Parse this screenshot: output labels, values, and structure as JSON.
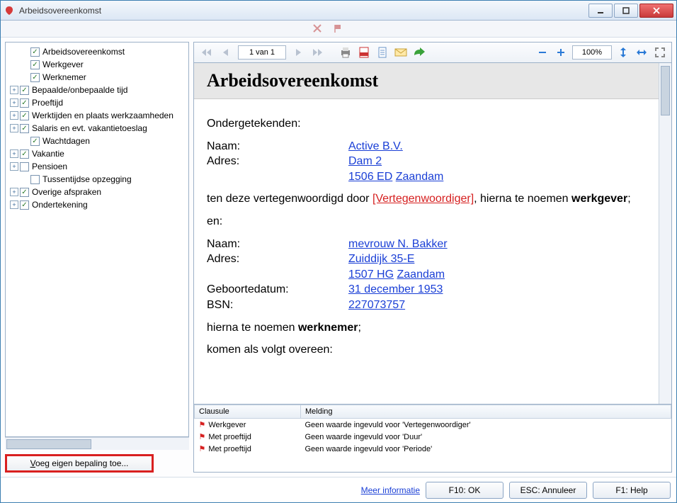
{
  "window": {
    "title": "Arbeidsovereenkomst"
  },
  "tree": {
    "items": [
      {
        "label": "Arbeidsovereenkomst",
        "checked": true,
        "expandable": false,
        "indent": 1
      },
      {
        "label": "Werkgever",
        "checked": true,
        "expandable": false,
        "indent": 1
      },
      {
        "label": "Werknemer",
        "checked": true,
        "expandable": false,
        "indent": 1
      },
      {
        "label": "Bepaalde/onbepaalde tijd",
        "checked": true,
        "expandable": true,
        "indent": 0
      },
      {
        "label": "Proeftijd",
        "checked": true,
        "expandable": true,
        "indent": 0
      },
      {
        "label": "Werktijden en plaats werkzaamheden",
        "checked": true,
        "expandable": true,
        "indent": 0
      },
      {
        "label": "Salaris en evt. vakantietoeslag",
        "checked": true,
        "expandable": true,
        "indent": 0
      },
      {
        "label": "Wachtdagen",
        "checked": true,
        "expandable": false,
        "indent": 1
      },
      {
        "label": "Vakantie",
        "checked": true,
        "expandable": true,
        "indent": 0
      },
      {
        "label": "Pensioen",
        "checked": false,
        "expandable": true,
        "indent": 0
      },
      {
        "label": "Tussentijdse opzegging",
        "checked": false,
        "expandable": false,
        "indent": 1
      },
      {
        "label": "Overige afspraken",
        "checked": true,
        "expandable": true,
        "indent": 0
      },
      {
        "label": "Ondertekening",
        "checked": true,
        "expandable": true,
        "indent": 0
      }
    ]
  },
  "add_button": "Voeg eigen bepaling toe...",
  "toolbar": {
    "page_display": "1 van 1",
    "zoom": "100%"
  },
  "document": {
    "heading": "Arbeidsovereenkomst",
    "subheading": "Ondergetekenden:",
    "employer": {
      "name_label": "Naam:",
      "name": "Active B.V.",
      "address_label": "Adres:",
      "street": "Dam 2",
      "postal": "1506 ED",
      "city": "Zaandam"
    },
    "rep_text_pre": "ten deze vertegenwoordigd door ",
    "rep_placeholder": "[Vertegenwoordiger]",
    "rep_text_post": ", hierna te noemen ",
    "rep_bold": "werkgever",
    "and": "en:",
    "employee": {
      "name_label": "Naam:",
      "name": "mevrouw N. Bakker",
      "address_label": "Adres:",
      "street": "Zuiddijk 35-E",
      "postal": "1507 HG",
      "city": "Zaandam",
      "dob_label": "Geboortedatum:",
      "dob": "31 december 1953",
      "bsn_label": "BSN:",
      "bsn": "227073757"
    },
    "after_emp_pre": "hierna te noemen ",
    "after_emp_bold": "werknemer",
    "agree": "komen als volgt overeen:"
  },
  "messages": {
    "col_clause": "Clausule",
    "col_msg": "Melding",
    "rows": [
      {
        "clause": "Werkgever",
        "msg": "Geen waarde ingevuld voor 'Vertegenwoordiger'"
      },
      {
        "clause": "Met proeftijd",
        "msg": "Geen waarde ingevuld voor 'Duur'"
      },
      {
        "clause": "Met proeftijd",
        "msg": "Geen waarde ingevuld voor 'Periode'"
      }
    ]
  },
  "footer": {
    "more_info": "Meer informatie",
    "ok": "F10: OK",
    "cancel": "ESC: Annuleer",
    "help": "F1: Help"
  }
}
